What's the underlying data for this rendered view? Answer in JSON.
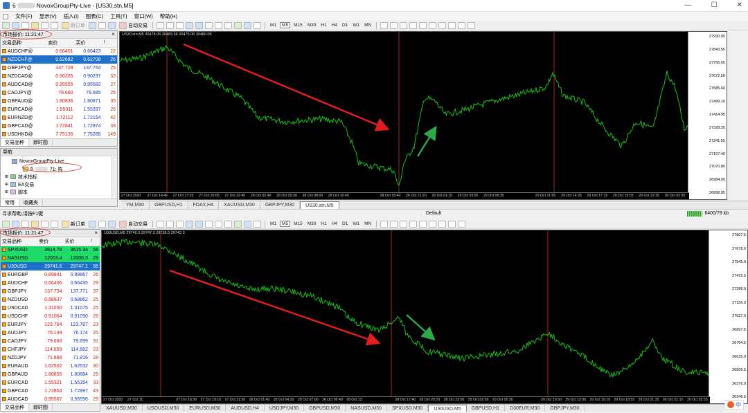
{
  "window": {
    "title_prefix": "6",
    "title_suffix": "NovoxGroupPty-Live - [US30.stn,M5]",
    "controls": [
      "—",
      "☐",
      "✕"
    ]
  },
  "menu": [
    "文件(F)",
    "显示(V)",
    "插入(I)",
    "图表(C)",
    "工具(T)",
    "窗口(W)",
    "帮助(H)"
  ],
  "toolbar": {
    "new_order": "新订单",
    "auto_trade": "自动交易",
    "timeframes": [
      "M1",
      "M5",
      "M15",
      "M30",
      "H1",
      "H4",
      "D1",
      "W1",
      "MN"
    ],
    "new_order_bottom": "新订单",
    "auto_trade_bottom": "自动交易"
  },
  "market_watch_top": {
    "title": "市场报价: 11:21:47",
    "columns": [
      "交易品种",
      "卖价",
      "买价",
      "!"
    ],
    "rows": [
      {
        "symbol": "AUDCHF@",
        "bid": "0.66401",
        "ask": "0.66423",
        "spread": "22"
      },
      {
        "symbol": "NZDCHF@",
        "bid": "0.62682",
        "ask": "0.62708",
        "spread": "26"
      },
      {
        "symbol": "GBPJPY@",
        "bid": "137.729",
        "ask": "137.754",
        "spread": "25"
      },
      {
        "symbol": "NZDCAD@",
        "bid": "0.90205",
        "ask": "0.90237",
        "spread": "32"
      },
      {
        "symbol": "AUDCAD@",
        "bid": "0.95555",
        "ask": "0.95582",
        "spread": "27"
      },
      {
        "symbol": "CADJPY@",
        "bid": "79.660",
        "ask": "79.685",
        "spread": "25"
      },
      {
        "symbol": "GBPAUD@",
        "bid": "1.80836",
        "ask": "1.80871",
        "spread": "35"
      },
      {
        "symbol": "EURCAD@",
        "bid": "1.55311",
        "ask": "1.55337",
        "spread": "26"
      },
      {
        "symbol": "EURNZD@",
        "bid": "1.72112",
        "ask": "1.72154",
        "spread": "42"
      },
      {
        "symbol": "GBPCAD@",
        "bid": "1.72841",
        "ask": "1.72874",
        "spread": "33"
      },
      {
        "symbol": "USDHKD@",
        "bid": "7.75136",
        "ask": "7.75285",
        "spread": "149"
      }
    ],
    "tabs": [
      "交易品种",
      "即时图"
    ]
  },
  "navigator": {
    "title": "导航",
    "account_server": "NovoxGroupPty-Live",
    "account_prefix": "6",
    "account_suffix": "71: 陈",
    "items": [
      "技术指标",
      "EA交易",
      "脚本"
    ],
    "tabs": [
      "常用",
      "收藏夹"
    ]
  },
  "chart_top": {
    "label": "US30.stn,M5  30478.06 30483.56 30475.06 30480.06",
    "y_ticks": [
      "27930.05",
      "27843.56",
      "27756.65",
      "27672.50",
      "27585.60",
      "27499.10",
      "27414.95",
      "27328.25",
      "27241.55",
      "27157.40",
      "27070.80",
      "26984.00",
      "26898.85"
    ],
    "x_ticks": [
      "27 Oct 2020",
      "27 Oct 14:45",
      "27 Oct 17:25",
      "27 Oct 20:05",
      "27 Oct 22:45",
      "28 Oct 02:40",
      "28 Oct 05:20",
      "28 Oct 08:00",
      "28 Oct 10:40",
      "",
      "28 Oct 18:40",
      "28 Oct 21:20",
      "29 Oct 01:15",
      "29 Oct 03:55",
      "29 Oct 06:35",
      "",
      "29 Oct 11:55",
      "29 Oct 14:35",
      "29 Oct 17:15",
      "29 Oct 19:55",
      "29 Oct 22:35",
      "30 Oct 02:30"
    ],
    "tabs": [
      "YM,M30",
      "GBPUSD,H1",
      "FDAX,H4",
      "XAUUSD,M30",
      "GBPJPY,M30",
      "US30.stn,M5"
    ]
  },
  "status_mid": {
    "left": "寻求帮助,请按F1键",
    "center": "Default",
    "traffic": "6400/79 kb"
  },
  "market_watch_bottom": {
    "title": "市场报价: 11:21:47",
    "columns": [
      "交易品种",
      "卖价",
      "买价",
      "!"
    ],
    "rows": [
      {
        "symbol": "SPXUSD",
        "bid": "3614.78",
        "ask": "3615.34",
        "spread": "56"
      },
      {
        "symbol": "NASUSD",
        "bid": "12003.4",
        "ask": "12006.3",
        "spread": "29"
      },
      {
        "symbol": "U30USD",
        "bid": "29741.6",
        "ask": "29747.1",
        "spread": "55"
      },
      {
        "symbol": "EURGBP",
        "bid": "0.89841",
        "ask": "0.89867",
        "spread": "26"
      },
      {
        "symbol": "AUDCHF",
        "bid": "0.66406",
        "ask": "0.66435",
        "spread": "29"
      },
      {
        "symbol": "GBPJPY",
        "bid": "137.734",
        "ask": "137.771",
        "spread": "37"
      },
      {
        "symbol": "NZDUSD",
        "bid": "0.68837",
        "ask": "0.68862",
        "spread": "25"
      },
      {
        "symbol": "USDCAD",
        "bid": "1.31050",
        "ask": "1.31075",
        "spread": "25"
      },
      {
        "symbol": "USDCHF",
        "bid": "0.91064",
        "ask": "0.91090",
        "spread": "26"
      },
      {
        "symbol": "EURJPY",
        "bid": "123.764",
        "ask": "123.787",
        "spread": "23"
      },
      {
        "symbol": "AUDJPY",
        "bid": "76.149",
        "ask": "76.174",
        "spread": "25"
      },
      {
        "symbol": "CADJPY",
        "bid": "79.668",
        "ask": "79.699",
        "spread": "31"
      },
      {
        "symbol": "CHFJPY",
        "bid": "114.659",
        "ask": "114.682",
        "spread": "23"
      },
      {
        "symbol": "NZDJPY",
        "bid": "71.888",
        "ask": "71.916",
        "spread": "28"
      },
      {
        "symbol": "EURAUD",
        "bid": "1.62502",
        "ask": "1.62532",
        "spread": "30"
      },
      {
        "symbol": "GBPAUD",
        "bid": "1.80855",
        "ask": "1.80884",
        "spread": "29"
      },
      {
        "symbol": "EURCAD",
        "bid": "1.55321",
        "ask": "1.55354",
        "spread": "33"
      },
      {
        "symbol": "GBPCAD",
        "bid": "1.72854",
        "ask": "1.72897",
        "spread": "43"
      },
      {
        "symbol": "AUDCAD",
        "bid": "0.95567",
        "ask": "0.95596",
        "spread": "29"
      }
    ],
    "tabs": [
      "交易品种",
      "即时图"
    ]
  },
  "chart_bottom": {
    "label": "U30USD,M5  29740.3 29747.3 29738.3 29742.3",
    "y_ticks": [
      "27807.5",
      "27678.0",
      "27545.0",
      "27415.5",
      "27286.0",
      "27156.0",
      "27027.0",
      "26897.5",
      "26764.5",
      "26635.0",
      "26505.5",
      "26376.0",
      "26246.5"
    ],
    "x_ticks": [
      "27 Oct 2020",
      "27 Oct 11:",
      "",
      "27 Oct 16:30",
      "27 Oct 19:10",
      "27 Oct 21:50",
      "28 Oct 01:40",
      "28 Oct 04:20",
      "28 Oct 07:00",
      "28 Oct 09:40",
      "28 Oct 12:",
      "",
      "28 Oct 17:40",
      "28 Oct 20:20",
      "28 Oct 23:00",
      "29 Oct 02:50",
      "29 Oct 05:30",
      "",
      "29 Oct 10:50",
      "29 Oct 13:30",
      "29 Oct 16:10",
      "29 Oct 18:55",
      "29 Oct 21:35",
      "30 Oct 01:15",
      "30 Oct 03:55"
    ],
    "tabs": [
      "XAUUSD,M30",
      "USOUSD,M30",
      "EURUSD,M30",
      "AUDUSD,H4",
      "USDJPY,M30",
      "GBPUSD,M30",
      "NASUSD,M30",
      "SPXUSD,M30",
      "U30USD,M5",
      "GBPUSD,H1",
      "D30EUR,M30",
      "GBPJPY,M30"
    ]
  },
  "colors": {
    "bid": "#d11111",
    "ask": "#1637b8",
    "candles": "#18c018",
    "trend_arrow_down": "#e01e1e",
    "trend_arrow_up": "#2ea84a",
    "selected_row": "#1e70c8",
    "highlight_row": "#1fdc6a"
  },
  "ime": {
    "label": "中"
  }
}
